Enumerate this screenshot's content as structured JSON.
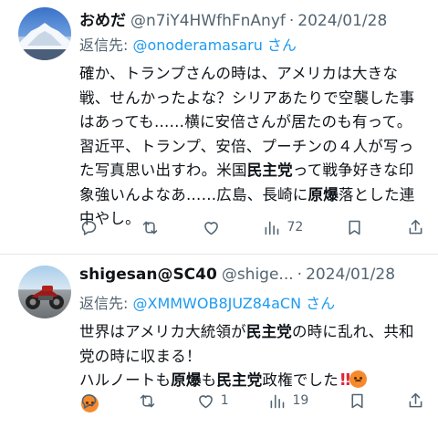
{
  "tweets": [
    {
      "display_name": "おめだ",
      "handle": "@n7iY4HWfhFnAnyf",
      "separator": "·",
      "date": "2024/01/28",
      "reply_prefix": "返信先: ",
      "reply_to": "@onoderamasaru",
      "reply_suffix": " さん",
      "text_parts": {
        "p1": "確か、トランプさんの時は、アメリカは大きな戦、せんかったよな？シリアあたりで空襲した事はあっても……横に安倍さんが居たのも有って。習近平、トランプ、安倍、プーチンの４人が写った写真思い出すわ。米国",
        "b1": "民主党",
        "p2": "って戦争好きな印象強いんよなあ……広島、長崎に",
        "b2": "原爆",
        "p3": "落とした連中やし。"
      },
      "views": "72"
    },
    {
      "display_name": "shigesan@SC40",
      "handle": "@shige...",
      "separator": "·",
      "date": "2024/01/28",
      "reply_prefix": "返信先: ",
      "reply_to": "@XMMWOB8JUZ84aCN",
      "reply_suffix": " さん",
      "text_parts": {
        "p1": "世界はアメリカ大統領が",
        "b1": "民主党",
        "p2": "の時に乱れ、共和党の時に収まる！",
        "p3": "ハルノートも",
        "b2": "原爆",
        "p4": "も",
        "b3": "民主党",
        "p5": "政権でした",
        "bang": "‼"
      },
      "likes": "1",
      "views": "19"
    }
  ],
  "icons": [
    "reply-icon",
    "retweet-icon",
    "like-icon",
    "views-icon",
    "bookmark-icon",
    "share-icon",
    "pouting-face-emoji"
  ]
}
